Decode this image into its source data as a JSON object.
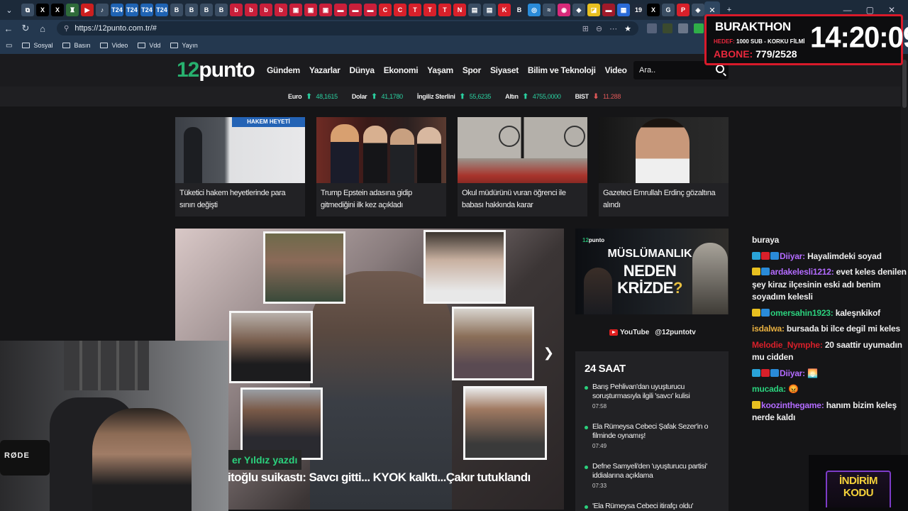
{
  "browser": {
    "tab_favicons": [
      {
        "glyph": "⧉",
        "color": "#3a4d63"
      },
      {
        "glyph": "X",
        "color": "#000000"
      },
      {
        "glyph": "X",
        "color": "#000000"
      },
      {
        "glyph": "♜",
        "color": "#2f6b3a"
      },
      {
        "glyph": "▶",
        "color": "#cc1f1f"
      },
      {
        "glyph": "♪",
        "color": "#3a4d63"
      },
      {
        "glyph": "T24",
        "color": "#1f63b3"
      },
      {
        "glyph": "T24",
        "color": "#1f63b3"
      },
      {
        "glyph": "T24",
        "color": "#1f63b3"
      },
      {
        "glyph": "T24",
        "color": "#1f63b3"
      },
      {
        "glyph": "B",
        "color": "#3a4d63"
      },
      {
        "glyph": "B",
        "color": "#3a4d63"
      },
      {
        "glyph": "B",
        "color": "#3a4d63"
      },
      {
        "glyph": "B",
        "color": "#3a4d63"
      },
      {
        "glyph": "b",
        "color": "#c91f3a"
      },
      {
        "glyph": "b",
        "color": "#c91f3a"
      },
      {
        "glyph": "b",
        "color": "#c91f3a"
      },
      {
        "glyph": "b",
        "color": "#c91f3a"
      },
      {
        "glyph": "▣",
        "color": "#c91f3a"
      },
      {
        "glyph": "▣",
        "color": "#c91f3a"
      },
      {
        "glyph": "▣",
        "color": "#c91f3a"
      },
      {
        "glyph": "▬",
        "color": "#c91f3a"
      },
      {
        "glyph": "▬",
        "color": "#c91f3a"
      },
      {
        "glyph": "▬",
        "color": "#c91f3a"
      },
      {
        "glyph": "C",
        "color": "#d8202a"
      },
      {
        "glyph": "C",
        "color": "#d8202a"
      },
      {
        "glyph": "T",
        "color": "#d8202a"
      },
      {
        "glyph": "T",
        "color": "#d8202a"
      },
      {
        "glyph": "T",
        "color": "#d8202a"
      },
      {
        "glyph": "N",
        "color": "#d8202a"
      },
      {
        "glyph": "▤",
        "color": "#3a4d63"
      },
      {
        "glyph": "▤",
        "color": "#3a4d63"
      },
      {
        "glyph": "K",
        "color": "#d8202a"
      },
      {
        "glyph": "B",
        "color": "#1f2a3a"
      },
      {
        "glyph": "◎",
        "color": "#2a8bd8"
      },
      {
        "glyph": "≈",
        "color": "#3a4d63"
      },
      {
        "glyph": "◉",
        "color": "#d82a7a"
      },
      {
        "glyph": "◆",
        "color": "#3a4d63"
      },
      {
        "glyph": "◪",
        "color": "#e8c020"
      },
      {
        "glyph": "▬",
        "color": "#a01a2a"
      },
      {
        "glyph": "▦",
        "color": "#2a6bd8"
      },
      {
        "glyph": "19",
        "color": "#1f2a3a"
      },
      {
        "glyph": "X",
        "color": "#000000"
      },
      {
        "glyph": "G",
        "color": "#3a4d63"
      },
      {
        "glyph": "P",
        "color": "#d8202a"
      },
      {
        "glyph": "◈",
        "color": "#3a4d63"
      }
    ],
    "active_tab_close": "✕",
    "new_tab": "+",
    "window_controls": [
      "—",
      "▢",
      "✕"
    ],
    "url": "https://12punto.com.tr/#",
    "bookmarks": [
      "Sosyal",
      "Basın",
      "Video",
      "Vdd",
      "Yayın"
    ]
  },
  "site": {
    "logo_num": "12",
    "logo_word": "punto",
    "nav": [
      "Gündem",
      "Yazarlar",
      "Dünya",
      "Ekonomi",
      "Yaşam",
      "Spor",
      "Siyaset",
      "Bilim ve Teknoloji",
      "Video"
    ],
    "search_placeholder": "Ara..",
    "ticker": [
      {
        "label": "Euro",
        "value": "48,1615",
        "dir": "up"
      },
      {
        "label": "Dolar",
        "value": "41,1780",
        "dir": "up"
      },
      {
        "label": "İngiliz Sterlini",
        "value": "55,6235",
        "dir": "up"
      },
      {
        "label": "Altın",
        "value": "4755,0000",
        "dir": "up"
      },
      {
        "label": "BIST",
        "value": "11.288",
        "dir": "down"
      }
    ],
    "cards": [
      {
        "title": "Tüketici hakem heyetlerinde para sınırı değişti",
        "sign": "HAKEM HEYETİ"
      },
      {
        "title": "Trump Epstein adasına gidip gitmediğini ilk kez açıkladı"
      },
      {
        "title": "Okul müdürünü vuran öğrenci ile babası hakkında karar"
      },
      {
        "title": "Gazeteci Emrullah Erdinç gözaltına alındı"
      }
    ],
    "hero": {
      "author": "er Yıldız yazdı",
      "headline": "itoğlu suikastı: Savcı gitti... KYOK kalktı...Çakır tutuklandı"
    },
    "ad": {
      "logo_num": "12",
      "logo_word": "punto",
      "line1": "MÜSLÜMANLIK",
      "line2": "NEDEN",
      "line3": "KRİZDE",
      "q": "?"
    },
    "youtube": {
      "label": "YouTube",
      "handle": "@12puntotv"
    },
    "h24": {
      "title": "24 SAAT",
      "items": [
        {
          "title": "Barış Pehlivan'dan uyuşturucu soruşturmasıyla ilgili 'savcı' kulisi",
          "time": "07:58"
        },
        {
          "title": "Ela Rümeysa Cebeci Şafak Sezer'in o filminde oynamış!",
          "time": "07:49"
        },
        {
          "title": "Defne Samyeli'den 'uyuşturucu partisi' iddialarına açıklama",
          "time": "07:33"
        },
        {
          "title": "'Ela Rümeysa Cebeci itirafçı oldu'",
          "time": ""
        }
      ]
    }
  },
  "stream": {
    "overlay": {
      "name": "BURAKTHON",
      "goal_label": "HEDEF:",
      "goal_text": "1000 SUB - KORKU FİLMİ",
      "subs_label": "ABONE:",
      "subs_value": "779/2528",
      "clock": "14:20:09"
    },
    "chat": [
      {
        "user": "",
        "text": "buraya",
        "color": "#eeeeee",
        "badges": []
      },
      {
        "user": "Diiyar:",
        "text": "Hayalimdeki soyad",
        "color": "#b36bff",
        "badges": [
          "#2aa3d8",
          "#d8202a",
          "#2a8bd8"
        ]
      },
      {
        "user": "ardakelesli1212:",
        "text": "evet keles denilen şey kiraz ilçesinin eski adı benim soyadım kelesli",
        "color": "#b36bff",
        "badges": [
          "#e8c020",
          "#2a8bd8"
        ]
      },
      {
        "user": "omersahin1923:",
        "text": "kaleşnkikof",
        "color": "#2bd17d",
        "badges": [
          "#e8c020",
          "#2a8bd8"
        ]
      },
      {
        "user": "isdalwa:",
        "text": "bursada bi ilce degil mi keles",
        "color": "#e8b040",
        "badges": []
      },
      {
        "user": "Melodie_Nymphe:",
        "text": "20 saattir uyumadın mu cidden",
        "color": "#d8202a",
        "badges": []
      },
      {
        "user": "Diiyar:",
        "text": "🌅",
        "color": "#b36bff",
        "badges": [
          "#2aa3d8",
          "#d8202a",
          "#2a8bd8"
        ]
      },
      {
        "user": "mucada:",
        "text": "😡",
        "color": "#2bd17d",
        "badges": []
      },
      {
        "user": "koozinthegame:",
        "text": "hanım bizim keleş nerde kaldı",
        "color": "#b36bff",
        "badges": [
          "#e8c020"
        ]
      }
    ],
    "promo": "İNDİRİM KODU",
    "mic_brand": "RØDE"
  }
}
